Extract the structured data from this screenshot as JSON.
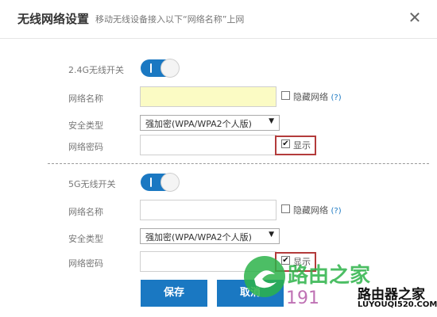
{
  "dialog": {
    "title": "无线网络设置",
    "subtitle": "移动无线设备接入以下“网络名称”上网",
    "close_icon": "close-icon"
  },
  "band_24": {
    "switch_label": "2.4G无线开关",
    "switch_on": true,
    "ssid_label": "网络名称",
    "ssid_value": "",
    "hide_label": "隐藏网络",
    "hide_help": "(?)",
    "hide_checked": false,
    "security_label": "安全类型",
    "security_value": "强加密(WPA/WPA2个人版)",
    "password_label": "网络密码",
    "password_value": "",
    "show_label": "显示",
    "show_checked": true
  },
  "band_5": {
    "switch_label": "5G无线开关",
    "switch_on": true,
    "ssid_label": "网络名称",
    "ssid_value": "",
    "hide_label": "隐藏网络",
    "hide_help": "(?)",
    "hide_checked": false,
    "security_label": "安全类型",
    "security_value": "强加密(WPA/WPA2个人版)",
    "password_label": "网络密码",
    "password_value": "",
    "show_label": "显示",
    "show_checked": true
  },
  "buttons": {
    "save": "保存",
    "cancel": "取消"
  },
  "watermark": {
    "text_cn": "路由之家",
    "number": "191",
    "brand": "路由器之家",
    "url": "LUYOUQI520.COM"
  },
  "colors": {
    "accent": "#1a78c2",
    "highlight_box": "#b33b3b",
    "autofill": "#fbfbc4"
  }
}
